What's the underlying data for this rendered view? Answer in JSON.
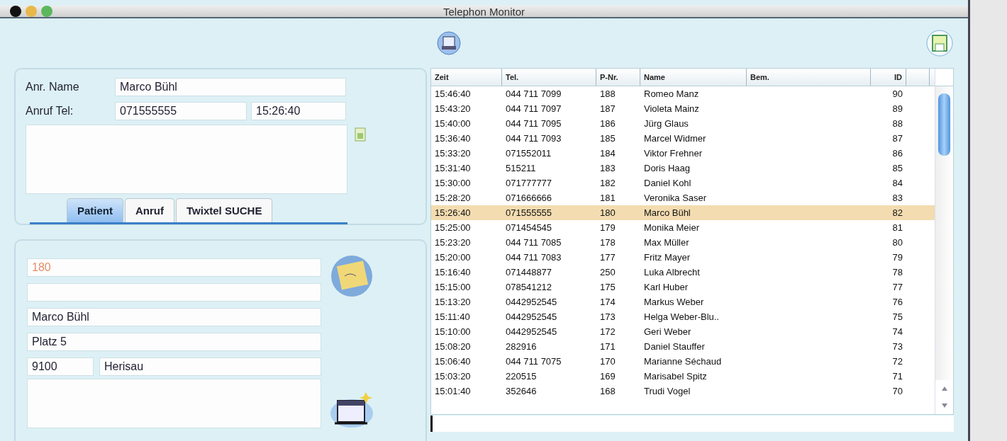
{
  "window": {
    "title": "Telephon Monitor"
  },
  "caller": {
    "name_label": "Anr. Name",
    "name": "Marco Bühl",
    "tel_label": "Anruf Tel:",
    "tel": "071555555",
    "time": "15:26:40"
  },
  "tabs": [
    {
      "label": "Patient",
      "selected": true
    },
    {
      "label": "Anruf",
      "selected": false
    },
    {
      "label": "Twixtel SUCHE",
      "selected": false
    }
  ],
  "patient": {
    "number": "180",
    "name": "Marco Bühl",
    "street": "Platz 5",
    "zip": "9100",
    "city": "Herisau"
  },
  "table": {
    "columns": [
      "Zeit",
      "Tel.",
      "P-Nr.",
      "Name",
      "Bem.",
      "ID"
    ],
    "rows": [
      {
        "zeit": "15:46:40",
        "tel": "044 711 7099",
        "pnr": "188",
        "name": "Romeo Manz",
        "id": "90",
        "selected": false
      },
      {
        "zeit": "15:43:20",
        "tel": "044 711 7097",
        "pnr": "187",
        "name": "Violeta Mainz",
        "id": "89",
        "selected": false
      },
      {
        "zeit": "15:40:00",
        "tel": "044 711 7095",
        "pnr": "186",
        "name": "Jürg Glaus",
        "id": "88",
        "selected": false
      },
      {
        "zeit": "15:36:40",
        "tel": "044 711 7093",
        "pnr": "185",
        "name": "Marcel Widmer",
        "id": "87",
        "selected": false
      },
      {
        "zeit": "15:33:20",
        "tel": "071552011",
        "pnr": "184",
        "name": "Viktor Frehner",
        "id": "86",
        "selected": false
      },
      {
        "zeit": "15:31:40",
        "tel": "515211",
        "pnr": "183",
        "name": "Doris Haag",
        "id": "85",
        "selected": false
      },
      {
        "zeit": "15:30:00",
        "tel": "071777777",
        "pnr": "182",
        "name": "Daniel Kohl",
        "id": "84",
        "selected": false
      },
      {
        "zeit": "15:28:20",
        "tel": "071666666",
        "pnr": "181",
        "name": "Veronika Saser",
        "id": "83",
        "selected": false
      },
      {
        "zeit": "15:26:40",
        "tel": "071555555",
        "pnr": "180",
        "name": "Marco Bühl",
        "id": "82",
        "selected": true
      },
      {
        "zeit": "15:25:00",
        "tel": "071454545",
        "pnr": "179",
        "name": "Monika Meier",
        "id": "81",
        "selected": false
      },
      {
        "zeit": "15:23:20",
        "tel": "044 711 7085",
        "pnr": "178",
        "name": "Max Müller",
        "id": "80",
        "selected": false
      },
      {
        "zeit": "15:20:00",
        "tel": "044 711 7083",
        "pnr": "177",
        "name": "Fritz Mayer",
        "id": "79",
        "selected": false
      },
      {
        "zeit": "15:16:40",
        "tel": "071448877",
        "pnr": "250",
        "name": "Luka Albrecht",
        "id": "78",
        "selected": false
      },
      {
        "zeit": "15:15:00",
        "tel": "078541212",
        "pnr": "175",
        "name": "Karl Huber",
        "id": "77",
        "selected": false
      },
      {
        "zeit": "15:13:20",
        "tel": "0442952545",
        "pnr": "174",
        "name": "Markus Weber",
        "id": "76",
        "selected": false
      },
      {
        "zeit": "15:11:40",
        "tel": "0442952545",
        "pnr": "173",
        "name": "Helga Weber-Blu..",
        "id": "75",
        "selected": false
      },
      {
        "zeit": "15:10:00",
        "tel": "0442952545",
        "pnr": "172",
        "name": "Geri Weber",
        "id": "74",
        "selected": false
      },
      {
        "zeit": "15:08:20",
        "tel": "282916",
        "pnr": "171",
        "name": "Daniel Stauffer",
        "id": "73",
        "selected": false
      },
      {
        "zeit": "15:06:40",
        "tel": "044 711 7075",
        "pnr": "170",
        "name": "Marianne Séchaud",
        "id": "72",
        "selected": false
      },
      {
        "zeit": "15:03:20",
        "tel": "220515",
        "pnr": "169",
        "name": "Marisabel Spitz",
        "id": "71",
        "selected": false
      },
      {
        "zeit": "15:01:40",
        "tel": "352646",
        "pnr": "168",
        "name": "Trudi Vogel",
        "id": "70",
        "selected": false
      }
    ]
  }
}
